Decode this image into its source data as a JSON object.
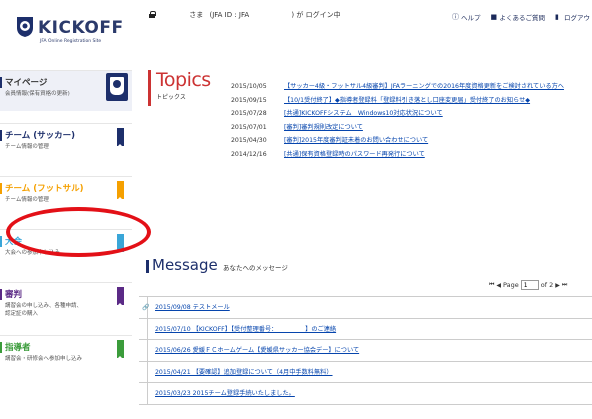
{
  "brand": {
    "logo_text": "KICKOFF",
    "logo_sub": "JFA Online Registration Site",
    "colors": {
      "navy": "#1d2f6b",
      "topics_red": "#cc3333",
      "link": "#0645ad",
      "highlight_ring": "#e31017"
    }
  },
  "login": {
    "name_label": "さま",
    "id_label": "(JFA ID : JFA",
    "suffix": ") が ログイン中"
  },
  "top_links": [
    {
      "icon": "help-icon",
      "label": "ヘルプ"
    },
    {
      "icon": "faq-icon",
      "label": "よくあるご質問"
    },
    {
      "icon": "logout-icon",
      "label": "ログアウト"
    }
  ],
  "sidebar": {
    "items": [
      {
        "title": "マイページ",
        "desc": "会員情報(保有資格の更新)",
        "color": "#1d2f6b"
      },
      {
        "title": "チーム (サッカー)",
        "desc": "チーム情報の管理",
        "color": "#1d2f6b"
      },
      {
        "title": "チーム (フットサル)",
        "desc": "チーム情報の管理",
        "color": "#f5a000"
      },
      {
        "title": "大会",
        "desc": "大会への参加申し込み",
        "color": "#3aa6d8"
      },
      {
        "title": "審判",
        "desc": "講習会の申し込み、各種申請、\n認定証の購入",
        "color": "#5b2a86"
      },
      {
        "title": "指導者",
        "desc": "講習会・研修会へ参加申し込み",
        "color": "#3b9c3b"
      }
    ]
  },
  "topics": {
    "title": "Topics",
    "subtitle": "トピックス",
    "items": [
      {
        "date": "2015/10/05",
        "text": "【サッカー4級・フットサル4級審判】JFAラーニングでの2016年度資格更新をご検討されている方へ"
      },
      {
        "date": "2015/09/15",
        "text": "【10/1受付終了】◆指導者登録料「登録料引き落とし口座変更届」受付終了のお知らせ◆"
      },
      {
        "date": "2015/07/28",
        "text": "[共通]KICKOFFシステム　Windows10対応状況について"
      },
      {
        "date": "2015/07/01",
        "text": "[審判]審判規則改定について"
      },
      {
        "date": "2015/04/30",
        "text": "[審判]2015年度審判証未着のお問い合わせについて"
      },
      {
        "date": "2014/12/16",
        "text": "[共通]保有資格登録時のパスワード再発行について"
      }
    ]
  },
  "message": {
    "title": "Message",
    "subtitle": "あなたへのメッセージ",
    "pager": {
      "first": "⏮",
      "prev": "◀",
      "page_label": "Page",
      "page_value": "1",
      "of_label": "of 2",
      "next": "▶",
      "last": "⏭"
    },
    "items": [
      {
        "clip": true,
        "text": "2015/09/08 テストメール"
      },
      {
        "clip": false,
        "text": "2015/07/10 【KICKOFF】【受付整理番号：　　　　　】のご連絡"
      },
      {
        "clip": false,
        "text": "2015/06/26 愛媛ＦＣホームゲーム【愛媛県サッカー協会デー】について"
      },
      {
        "clip": false,
        "text": "2015/04/21 【要確認】追加登録について（4月中手数料無料）"
      },
      {
        "clip": false,
        "text": "2015/03/23 2015チーム登録手続いたしました。"
      }
    ]
  }
}
